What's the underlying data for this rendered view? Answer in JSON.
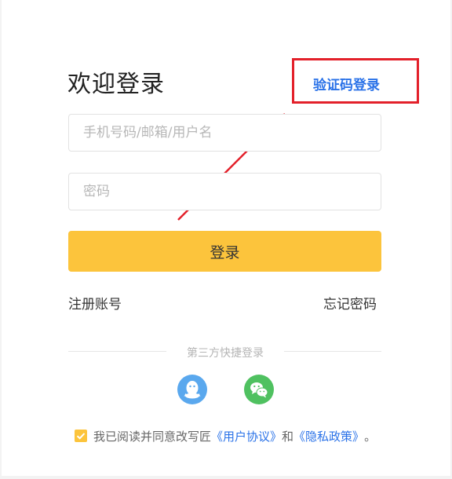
{
  "title": "欢迎登录",
  "sms_login_label": "验证码登录",
  "form": {
    "account_placeholder": "手机号码/邮箱/用户名",
    "password_placeholder": "密码",
    "login_button": "登录"
  },
  "links": {
    "register": "注册账号",
    "forgot_password": "忘记密码"
  },
  "third_party": {
    "label": "第三方快捷登录",
    "providers": [
      {
        "name": "QQ",
        "icon": "qq-icon",
        "color": "#5aa8ee"
      },
      {
        "name": "WeChat",
        "icon": "wechat-icon",
        "color": "#4fc160"
      }
    ]
  },
  "agreement": {
    "checked": true,
    "prefix": "我已阅读并同意改写匠",
    "user_agreement": "《用户协议》",
    "conjunction": "和",
    "privacy_policy": "《隐私政策》",
    "suffix": "。"
  },
  "colors": {
    "accent": "#fcc43c",
    "link": "#2a72e8",
    "annotation": "#e3202a"
  }
}
